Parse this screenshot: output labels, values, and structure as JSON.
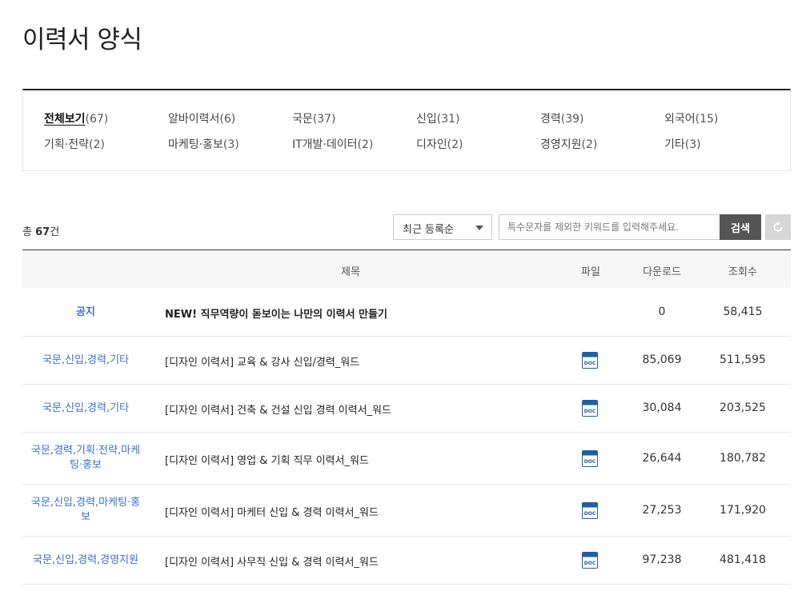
{
  "page_title": "이력서 양식",
  "categories": [
    {
      "name": "전체보기",
      "count": "(67)",
      "active": true
    },
    {
      "name": "알바이력서",
      "count": "(6)"
    },
    {
      "name": "국문",
      "count": "(37)"
    },
    {
      "name": "신입",
      "count": "(31)"
    },
    {
      "name": "경력",
      "count": "(39)"
    },
    {
      "name": "외국어",
      "count": "(15)"
    },
    {
      "name": "기획·전략",
      "count": "(2)"
    },
    {
      "name": "마케팅·홍보",
      "count": "(3)"
    },
    {
      "name": "IT개발·데이터",
      "count": "(2)"
    },
    {
      "name": "디자인",
      "count": "(2)"
    },
    {
      "name": "경영지원",
      "count": "(2)"
    },
    {
      "name": "기타",
      "count": "(3)"
    }
  ],
  "total": {
    "prefix": "총 ",
    "count": "67",
    "suffix": "건"
  },
  "sort": {
    "selected": "최근 등록순"
  },
  "search": {
    "placeholder": "특수문자를 제외한 키워드를 입력해주세요.",
    "button_label": "검색",
    "reset_icon": "refresh-icon"
  },
  "table": {
    "headers": {
      "title": "제목",
      "file": "파일",
      "downloads": "다운로드",
      "views": "조회수"
    },
    "rows": [
      {
        "category": "공지",
        "title": "NEW! 직무역량이 돋보이는 나만의 이력서 만들기",
        "file": "",
        "downloads": "0",
        "views": "58,415"
      },
      {
        "category": "국문,신입,경력,기타",
        "title": "[디자인 이력서] 교육 & 강사 신입/경력_워드",
        "file": "doc-icon",
        "downloads": "85,069",
        "views": "511,595"
      },
      {
        "category": "국문,신입,경력,기타",
        "title": "[디자인 이력서] 건축 & 건설 신입 경력 이력서_워드",
        "file": "doc-icon",
        "downloads": "30,084",
        "views": "203,525"
      },
      {
        "category": "국문,경력,기획·전략,마케팅·홍보",
        "title": "[디자인 이력서] 영업 & 기획 직무 이력서_워드",
        "file": "doc-icon",
        "downloads": "26,644",
        "views": "180,782"
      },
      {
        "category": "국문,신입,경력,마케팅·홍보",
        "title": "[디자인 이력서] 마케터 신입 & 경력 이력서_워드",
        "file": "doc-icon",
        "downloads": "27,253",
        "views": "171,920"
      },
      {
        "category": "국문,신입,경력,경영지원",
        "title": "[디자인 이력서] 사무직 신입 & 경력 이력서_워드",
        "file": "doc-icon",
        "downloads": "97,238",
        "views": "481,418"
      }
    ]
  },
  "colors": {
    "category_link": "#3b6fd1",
    "doc_icon": "#1f5ea8",
    "search_button": "#555555"
  }
}
